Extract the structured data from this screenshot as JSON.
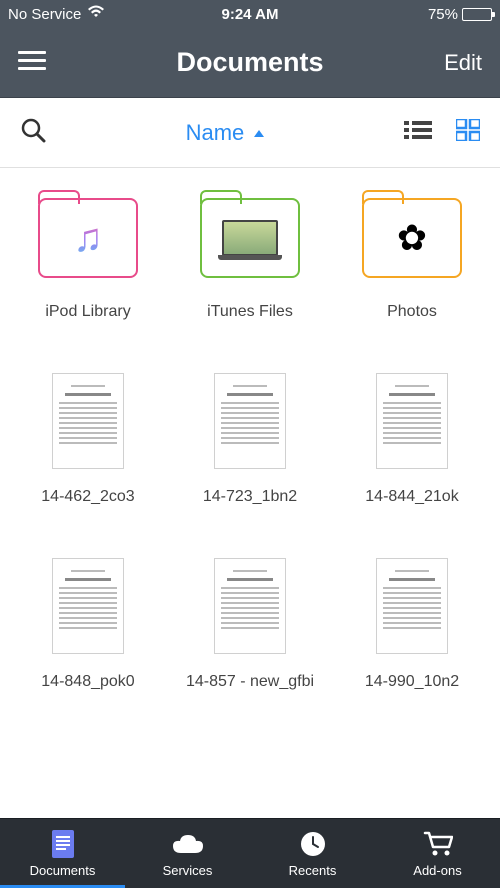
{
  "status": {
    "carrier": "No Service",
    "time": "9:24 AM",
    "battery_pct": "75%",
    "battery_fill_pct": 75
  },
  "nav": {
    "title": "Documents",
    "right": "Edit"
  },
  "toolbar": {
    "sort_label": "Name"
  },
  "colors": {
    "accent": "#2a8cf2",
    "tab_active": "#6b7cf0"
  },
  "folders": [
    {
      "label": "iPod Library",
      "color": "pink",
      "glyph": "music"
    },
    {
      "label": "iTunes Files",
      "color": "green",
      "glyph": "laptop"
    },
    {
      "label": "Photos",
      "color": "orange",
      "glyph": "flower"
    }
  ],
  "documents": [
    {
      "label": "14-462_2co3"
    },
    {
      "label": "14-723_1bn2"
    },
    {
      "label": "14-844_21ok"
    },
    {
      "label": "14-848_pok0"
    },
    {
      "label": "14-857 - new_gfbi"
    },
    {
      "label": "14-990_10n2"
    }
  ],
  "tabs": [
    {
      "label": "Documents",
      "icon": "doc",
      "active": true
    },
    {
      "label": "Services",
      "icon": "cloud",
      "active": false
    },
    {
      "label": "Recents",
      "icon": "clock",
      "active": false
    },
    {
      "label": "Add-ons",
      "icon": "cart",
      "active": false
    }
  ]
}
